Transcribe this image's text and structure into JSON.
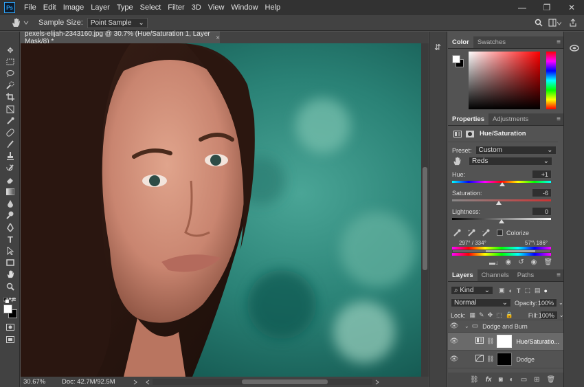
{
  "menubar": {
    "logo": "Ps",
    "items": [
      "File",
      "Edit",
      "Image",
      "Layer",
      "Type",
      "Select",
      "Filter",
      "3D",
      "View",
      "Window",
      "Help"
    ],
    "window_controls": [
      "—",
      "❐",
      "✕"
    ]
  },
  "options_bar": {
    "sample_size_label": "Sample Size:",
    "sample_size_value": "Point Sample"
  },
  "document": {
    "tab_title": "pexels-elijah-2343160.jpg @ 30.7% (Hue/Saturation 1, Layer Mask/8) *",
    "close_glyph": "×",
    "zoom": "30.67%",
    "doc_info": "Doc: 42.7M/92.5M"
  },
  "color_panel": {
    "tabs": [
      "Color",
      "Swatches"
    ],
    "active_tab": "Color"
  },
  "properties_panel": {
    "tabs": [
      "Properties",
      "Adjustments"
    ],
    "title": "Hue/Saturation",
    "preset_label": "Preset:",
    "preset_value": "Custom",
    "channel_value": "Reds",
    "hue_label": "Hue:",
    "hue_value": "+1",
    "saturation_label": "Saturation:",
    "saturation_value": "-6",
    "lightness_label": "Lightness:",
    "lightness_value": "0",
    "hue_slider": 0.505,
    "saturation_slider": 0.47,
    "lightness_slider": 0.5,
    "colorize_label": "Colorize",
    "range_left": "297° / 334°",
    "range_right": "57°\\ 186°"
  },
  "layers_panel": {
    "tabs": [
      "Layers",
      "Channels",
      "Paths"
    ],
    "filter_kind": "Kind",
    "blend_mode": "Normal",
    "opacity_label": "Opacity:",
    "opacity_value": "100%",
    "lock_label": "Lock:",
    "fill_label": "Fill:",
    "fill_value": "100%",
    "layers": [
      {
        "name": "Dodge and Burn",
        "type": "group"
      },
      {
        "name": "Hue/Saturation 1",
        "display": "Hue/Saturatio...",
        "type": "adjustment"
      },
      {
        "name": "Dodge",
        "type": "layer"
      }
    ],
    "bottom_icons": [
      "link-icon",
      "fx-icon",
      "mask-icon",
      "adjustment-icon",
      "folder-icon",
      "new-layer-icon",
      "trash-icon"
    ],
    "fx_label": "fx"
  },
  "colors": {
    "bg": "#535353",
    "panel_dark": "#424242",
    "menubar": "#323232",
    "accent": "#2fa3f5"
  }
}
